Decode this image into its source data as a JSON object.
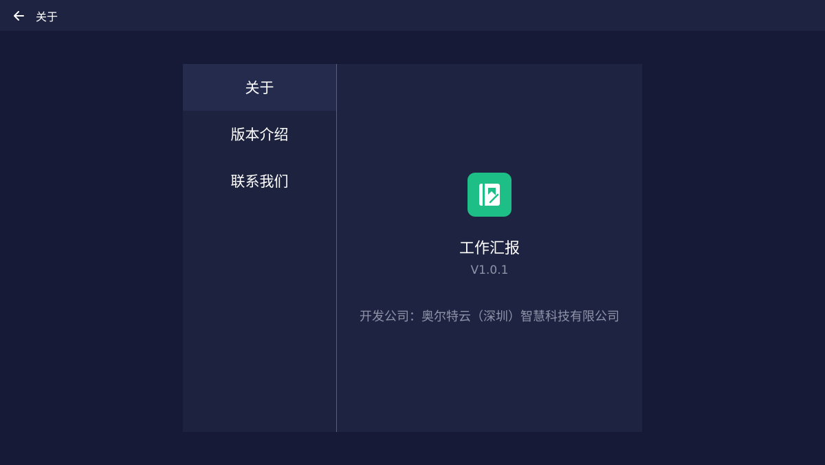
{
  "header": {
    "back_icon": "arrow-left-icon",
    "title": "关于"
  },
  "sidebar": {
    "items": [
      {
        "label": "关于",
        "active": true
      },
      {
        "label": "版本介绍",
        "active": false
      },
      {
        "label": "联系我们",
        "active": false
      }
    ]
  },
  "about": {
    "app_icon": "report-app-icon",
    "app_name": "工作汇报",
    "version": "V1.0.1",
    "company": "开发公司：奥尔特云（深圳）智慧科技有限公司"
  },
  "colors": {
    "background": "#161a36",
    "topbar": "#1e2341",
    "sidebar": "#1d223f",
    "sidebar_active": "#252b4c",
    "content": "#1e2341",
    "accent": "#1dbf86",
    "muted_text": "#8f93a8"
  }
}
